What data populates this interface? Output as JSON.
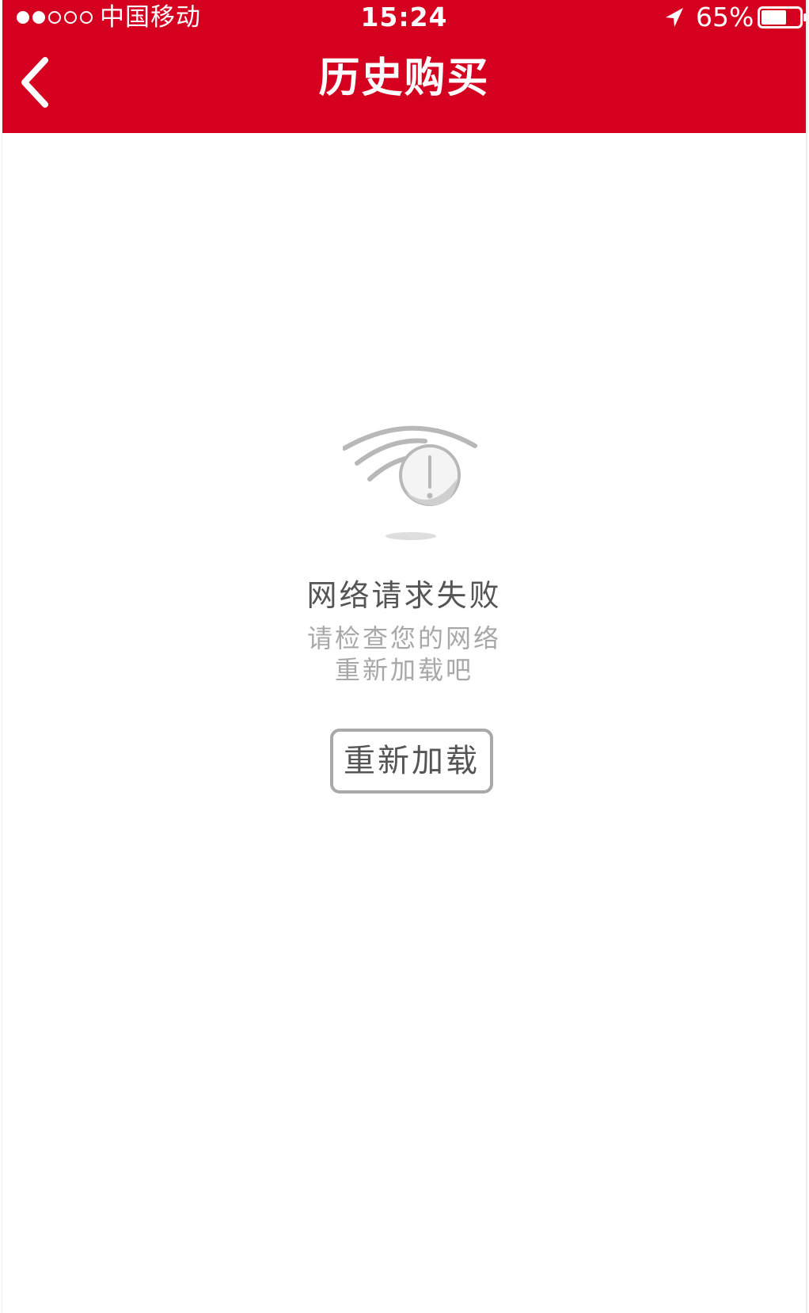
{
  "status_bar": {
    "carrier": "中国移动",
    "signal_bars_filled": 2,
    "signal_bars_total": 5,
    "time": "15:24",
    "location_icon": "location-arrow-icon",
    "battery_percent": "65%",
    "battery_level": 0.65
  },
  "nav_bar": {
    "back_icon": "chevron-left-icon",
    "title": "历史购买"
  },
  "error_state": {
    "icon": "wifi-error-icon",
    "title": "网络请求失败",
    "desc_line1": "请检查您的网络",
    "desc_line2": "重新加载吧",
    "reload_label": "重新加载"
  },
  "colors": {
    "brand_red": "#d50020",
    "text_dark": "#555555",
    "text_light": "#a8a8a8",
    "icon_gray": "#b8b8b8"
  }
}
